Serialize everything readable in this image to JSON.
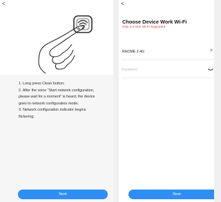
{
  "screen1": {
    "back_icon": "<",
    "icon": "finger-press-wifi-button",
    "instructions": [
      "1. Long press Clean button;",
      "2. After the voice \"Start network configuration,",
      "please wait for a moment\" is heard, the device",
      "goes to network configuration mode;",
      "3. Network configuration indicator begins",
      "flickering;"
    ],
    "next_label": "Next"
  },
  "screen2": {
    "back_icon": "<",
    "title": "Choose Device Work Wi-Fi",
    "subtitle": "Only 2.4 GHz Wi-Fi Supported",
    "wifi_name": "RHOME 2.4G",
    "wifi_chevron": ">",
    "password_placeholder": "Password",
    "password_value": "",
    "next_label": "Next"
  },
  "colors": {
    "accent": "#2f8ef3",
    "warning_text": "#d93a3a",
    "instructions_bg": "#f6f6f6"
  }
}
